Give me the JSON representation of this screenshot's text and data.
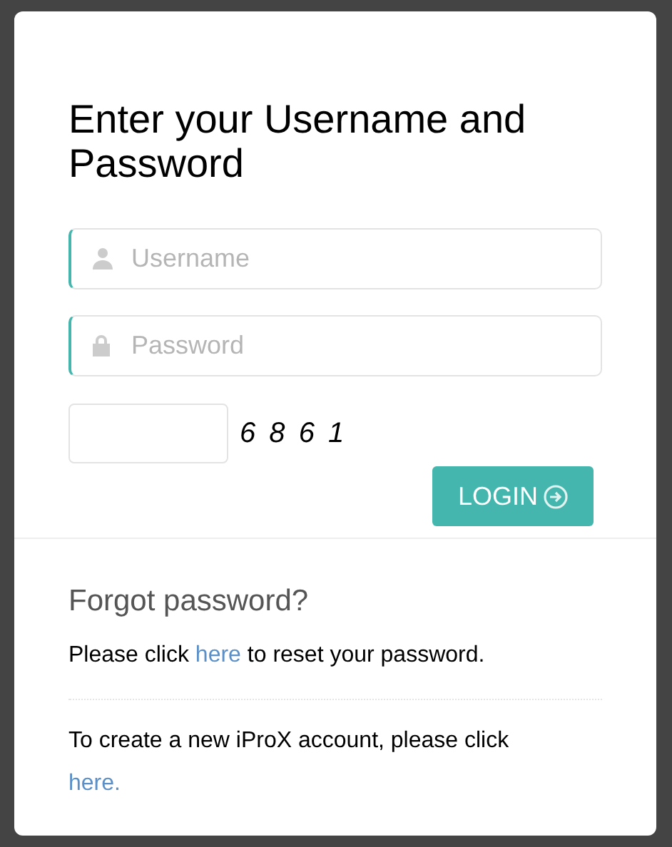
{
  "heading": "Enter your Username and Password",
  "fields": [
    {
      "kind": "user",
      "placeholder": "Username"
    },
    {
      "kind": "lock",
      "placeholder": "Password"
    }
  ],
  "captcha": {
    "code": "6 8 6 1"
  },
  "login_button": {
    "label": "LOGIN"
  },
  "forgot": {
    "title": "Forgot password?",
    "before": "Please click ",
    "link": "here",
    "after": " to reset your password."
  },
  "register": {
    "before": "To create a new iProX account, please click ",
    "link": "here."
  }
}
